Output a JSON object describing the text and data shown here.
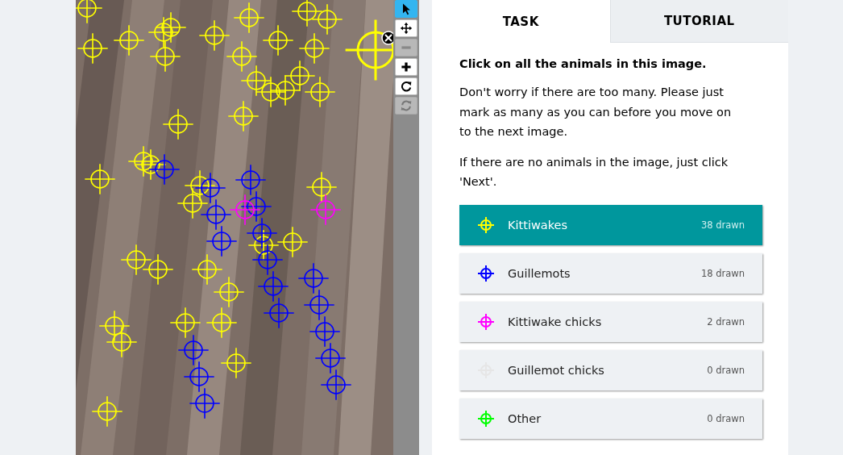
{
  "toolbar": [
    {
      "kind": "pointer",
      "selected": true,
      "disabled": false
    },
    {
      "kind": "move",
      "selected": false,
      "disabled": false
    },
    {
      "kind": "zoom-out",
      "selected": false,
      "disabled": true
    },
    {
      "kind": "zoom-in",
      "selected": false,
      "disabled": false
    },
    {
      "kind": "rotate",
      "selected": false,
      "disabled": false
    },
    {
      "kind": "reset",
      "selected": false,
      "disabled": true
    }
  ],
  "tabs": [
    {
      "label": "TASK",
      "selected": true
    },
    {
      "label": "TUTORIAL",
      "selected": false
    }
  ],
  "task": {
    "question": "Click on all the animals in this image.",
    "help": [
      "Don't worry if there are too many. Please just mark as many as you can before you move on to the next image.",
      "If there are no animals in the image, just click 'Next'."
    ]
  },
  "tools": [
    {
      "label": "Kittiwakes",
      "count": "38 drawn",
      "color": "#ffff00",
      "selected": true
    },
    {
      "label": "Guillemots",
      "count": "18 drawn",
      "color": "#0000ff",
      "selected": false
    },
    {
      "label": "Kittiwake chicks",
      "count": "2 drawn",
      "color": "#ff00ff",
      "selected": false
    },
    {
      "label": "Guillemot chicks",
      "count": "0 drawn",
      "color": "#e6e6e6",
      "selected": false
    },
    {
      "label": "Other",
      "count": "0 drawn",
      "color": "#00ff00",
      "selected": false
    }
  ]
}
